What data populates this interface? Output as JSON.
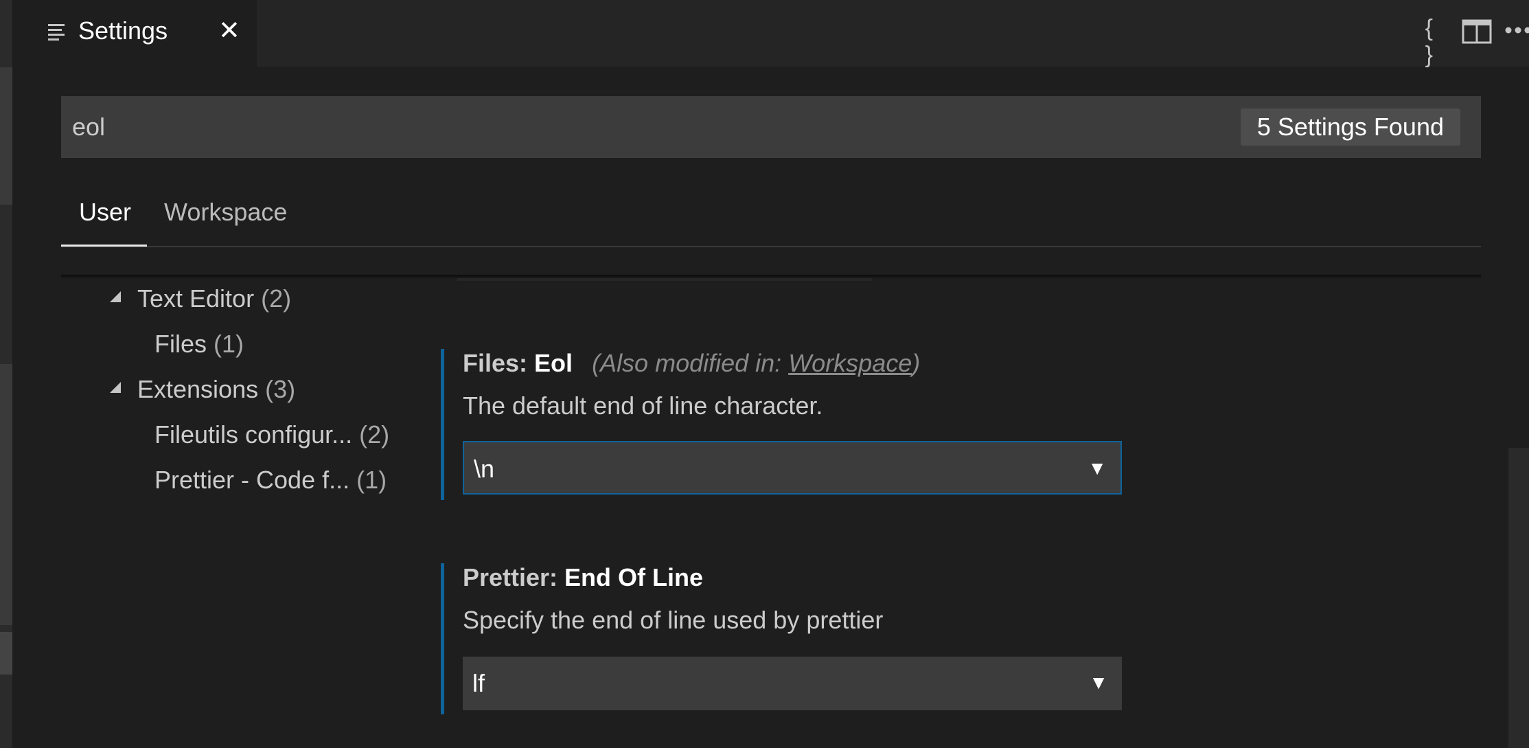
{
  "tab": {
    "title": "Settings",
    "close_glyph": "✕",
    "icon": "list-icon"
  },
  "header_actions": [
    {
      "name": "open-json-button",
      "glyph": "{ }"
    },
    {
      "name": "split-editor-button",
      "glyph": "◫"
    },
    {
      "name": "more-actions-button",
      "glyph": "···"
    }
  ],
  "search": {
    "value": "eol",
    "results_badge": "5 Settings Found"
  },
  "scopes": {
    "user": "User",
    "workspace": "Workspace",
    "active": "User"
  },
  "toc": {
    "text_editor": {
      "label": "Text Editor",
      "count": "(2)"
    },
    "files": {
      "label": "Files",
      "count": "(1)"
    },
    "extensions": {
      "label": "Extensions",
      "count": "(3)"
    },
    "fileutils": {
      "label": "Fileutils configur...",
      "count": "(2)"
    },
    "prettier": {
      "label": "Prettier - Code f...",
      "count": "(1)"
    }
  },
  "settings": {
    "files_eol": {
      "category": "Files: ",
      "name": "Eol",
      "modified_prefix": "(Also modified in: ",
      "modified_link": "Workspace",
      "modified_suffix": ")",
      "description": "The default end of line character.",
      "value": "\\n"
    },
    "prettier_eol": {
      "category": "Prettier: ",
      "name": "End Of Line",
      "description": "Specify the end of line used by prettier",
      "value": "lf"
    }
  },
  "colors": {
    "accent": "#0e639c",
    "background": "#1e1e1e",
    "input": "#3c3c3c"
  }
}
